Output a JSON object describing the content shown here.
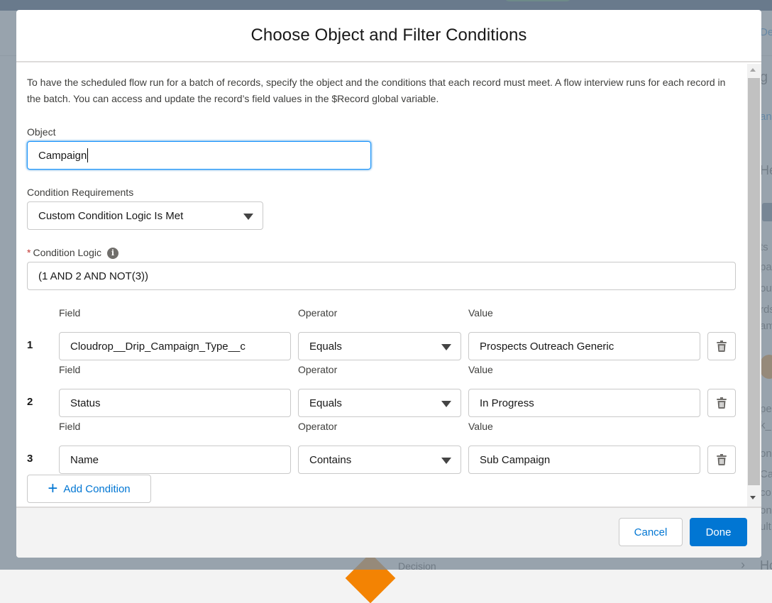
{
  "background": {
    "right_edge_fragments": [
      "De",
      "g",
      "an",
      "He",
      "ts",
      "pai",
      "out",
      "rds",
      "am",
      "pec",
      "k_",
      "on",
      "Ca",
      "co",
      "on",
      "ult",
      "Ho"
    ],
    "bottom_fragment": "Decision"
  },
  "modal": {
    "title": "Choose Object and Filter Conditions",
    "intro": "To have the scheduled flow run for a batch of records, specify the object and the conditions that each record must meet. A flow interview runs for each record in the batch. You can access and update the record’s field values in the $Record global variable.",
    "object": {
      "label": "Object",
      "value": "Campaign"
    },
    "condition_requirements": {
      "label": "Condition Requirements",
      "value": "Custom Condition Logic Is Met"
    },
    "condition_logic": {
      "required_marker": "*",
      "label": "Condition Logic",
      "info_glyph": "i",
      "value": "(1 AND 2 AND NOT(3))"
    },
    "column_labels": {
      "field": "Field",
      "operator": "Operator",
      "value": "Value"
    },
    "conditions": [
      {
        "num": "1",
        "field": "Cloudrop__Drip_Campaign_Type__c",
        "operator": "Equals",
        "value": "Prospects Outreach Generic"
      },
      {
        "num": "2",
        "field": "Status",
        "operator": "Equals",
        "value": "In Progress"
      },
      {
        "num": "3",
        "field": "Name",
        "operator": "Contains",
        "value": "Sub Campaign"
      }
    ],
    "add_condition": {
      "icon": "+",
      "label": "Add Condition"
    },
    "footer": {
      "cancel": "Cancel",
      "done": "Done"
    }
  },
  "colors": {
    "brand": "#0176d3",
    "focus": "#1b96ff",
    "required": "#c23934"
  },
  "icons": [
    "info-icon",
    "chevron-down-icon",
    "trash-icon",
    "plus-icon"
  ]
}
